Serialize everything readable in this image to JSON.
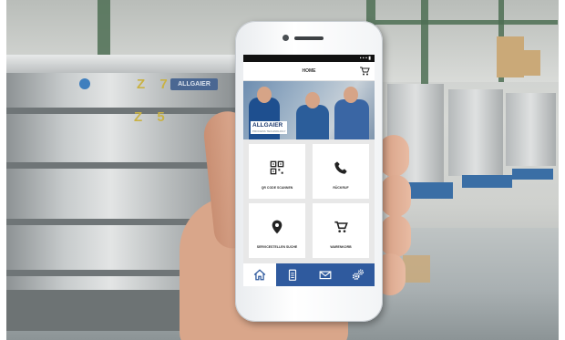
{
  "scene": {
    "machine_labels": [
      "Z 7",
      "Z 5"
    ],
    "machine_brand": "ALLGAIER"
  },
  "phone": {
    "screen_title": "HOME",
    "cart_icon": "cart-icon",
    "hero": {
      "brand": "ALLGAIER",
      "brand_sub": "PROCESS TECHNOLOGY"
    },
    "tiles": [
      {
        "label": "QR CODE SCANNEN",
        "icon": "qr-code-icon"
      },
      {
        "label": "RÜCKRUF",
        "icon": "phone-icon"
      },
      {
        "label": "SERVICESTELLEN SUCHE",
        "icon": "location-pin-icon"
      },
      {
        "label": "WARENKORB",
        "icon": "cart-icon"
      }
    ],
    "tabs": [
      {
        "icon": "home-icon",
        "active": true
      },
      {
        "icon": "clipboard-icon",
        "active": false
      },
      {
        "icon": "mail-icon",
        "active": false
      },
      {
        "icon": "gears-icon",
        "active": false
      }
    ]
  },
  "colors": {
    "app_blue": "#2f5a9e",
    "tile_bg": "#ffffff"
  }
}
